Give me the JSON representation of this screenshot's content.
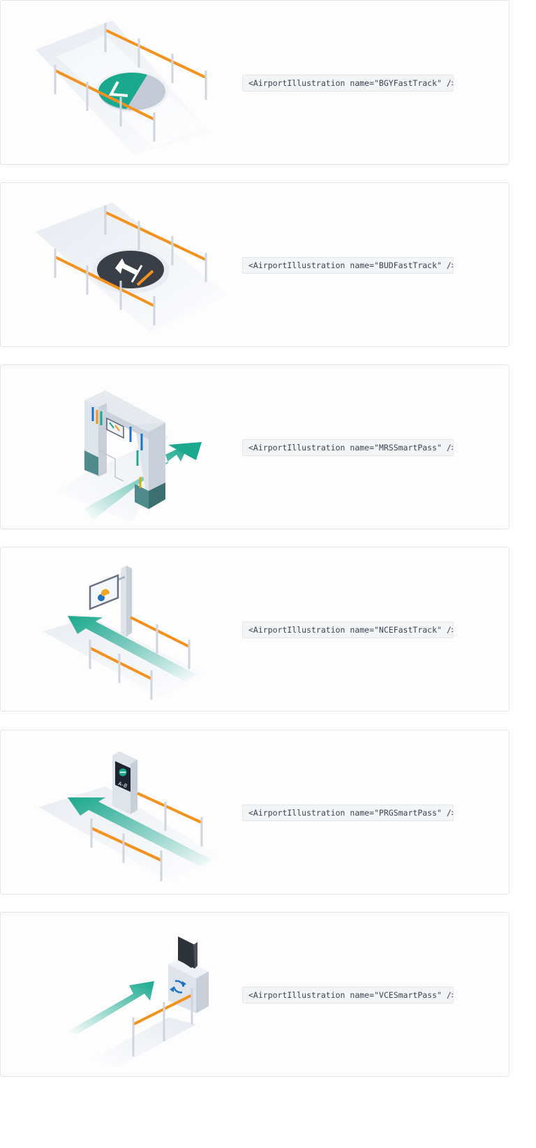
{
  "illustrations": [
    {
      "id": "BGYFastTrack",
      "snippet": "<AirportIllustration name=\"BGYFastTrack\" />"
    },
    {
      "id": "BUDFastTrack",
      "snippet": "<AirportIllustration name=\"BUDFastTrack\" />"
    },
    {
      "id": "MRSSmartPass",
      "snippet": "<AirportIllustration name=\"MRSSmartPass\" />"
    },
    {
      "id": "NCEFastTrack",
      "snippet": "<AirportIllustration name=\"NCEFastTrack\" />"
    },
    {
      "id": "PRGSmartPass",
      "snippet": "<AirportIllustration name=\"PRGSmartPass\" />"
    },
    {
      "id": "VCESmartPass",
      "snippet": "<AirportIllustration name=\"VCESmartPass\" />"
    }
  ],
  "sign_text": {
    "prg": "A–B"
  },
  "colors": {
    "teal": "#1aa88e",
    "orange": "#f5921e",
    "dark": "#3a3f47",
    "post": "#cfd5de",
    "floor": "#e7ebf1"
  }
}
